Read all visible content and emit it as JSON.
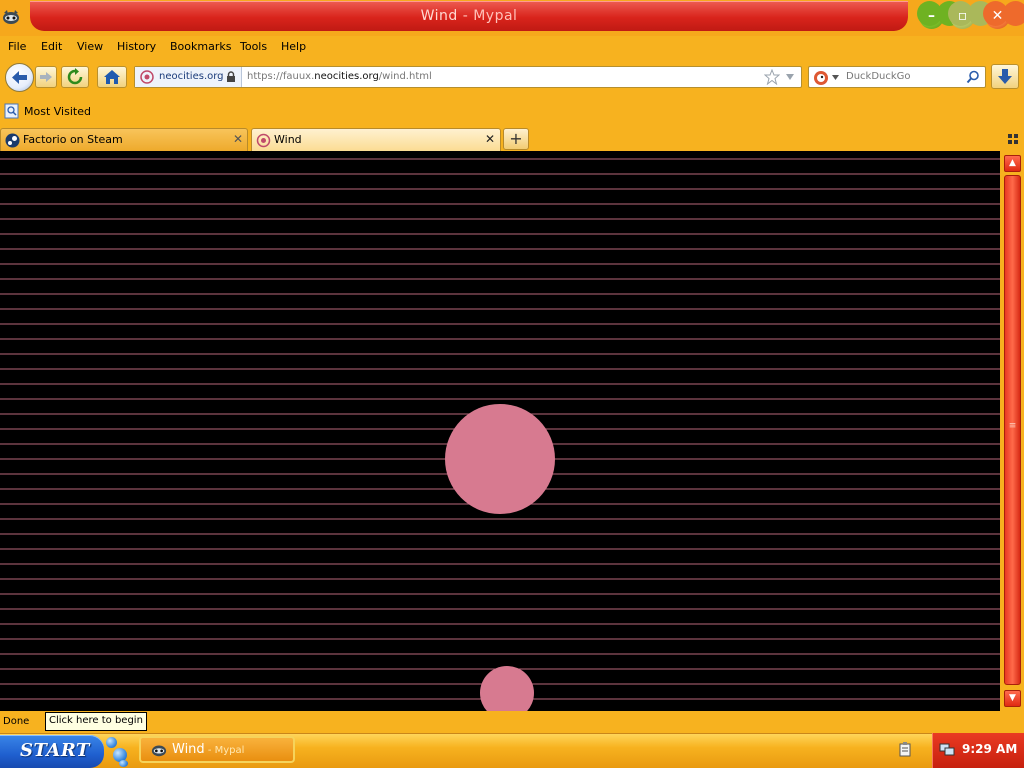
{
  "window": {
    "title": "Wind",
    "title_app": " - Mypal",
    "icon": "mypal-raccoon-icon",
    "controls": [
      "minimize-icon",
      "maximize-icon",
      "close-icon"
    ]
  },
  "menu": {
    "file": "File",
    "edit": "Edit",
    "view": "View",
    "history": "History",
    "bookmarks": "Bookmarks",
    "tools": "Tools",
    "help": "Help"
  },
  "nav": {
    "identity": "neocities.org",
    "url_prefix": "https://fauux.",
    "url_host": "neocities.org",
    "url_path": "/wind.html",
    "search_placeholder": "DuckDuckGo"
  },
  "bookmarks_bar": {
    "most_visited": "Most Visited"
  },
  "tabs": [
    {
      "title": "Factorio on Steam",
      "active": false,
      "icon": "steam-icon"
    },
    {
      "title": "Wind",
      "active": true,
      "icon": "neocities-icon"
    }
  ],
  "page": {
    "background": "#000000",
    "line_color": "#d77a90",
    "circle_color": "#d77a90"
  },
  "status": {
    "text": "Done",
    "tooltip": "Click here to begin"
  },
  "taskbar": {
    "start_label": "START",
    "task_title": "Wind",
    "task_app": " - Mypal",
    "clock": "9:29 AM"
  },
  "colors": {
    "chrome": "#f7b21f",
    "title_red": "#d9241c",
    "start_blue": "#1f5fcf"
  }
}
